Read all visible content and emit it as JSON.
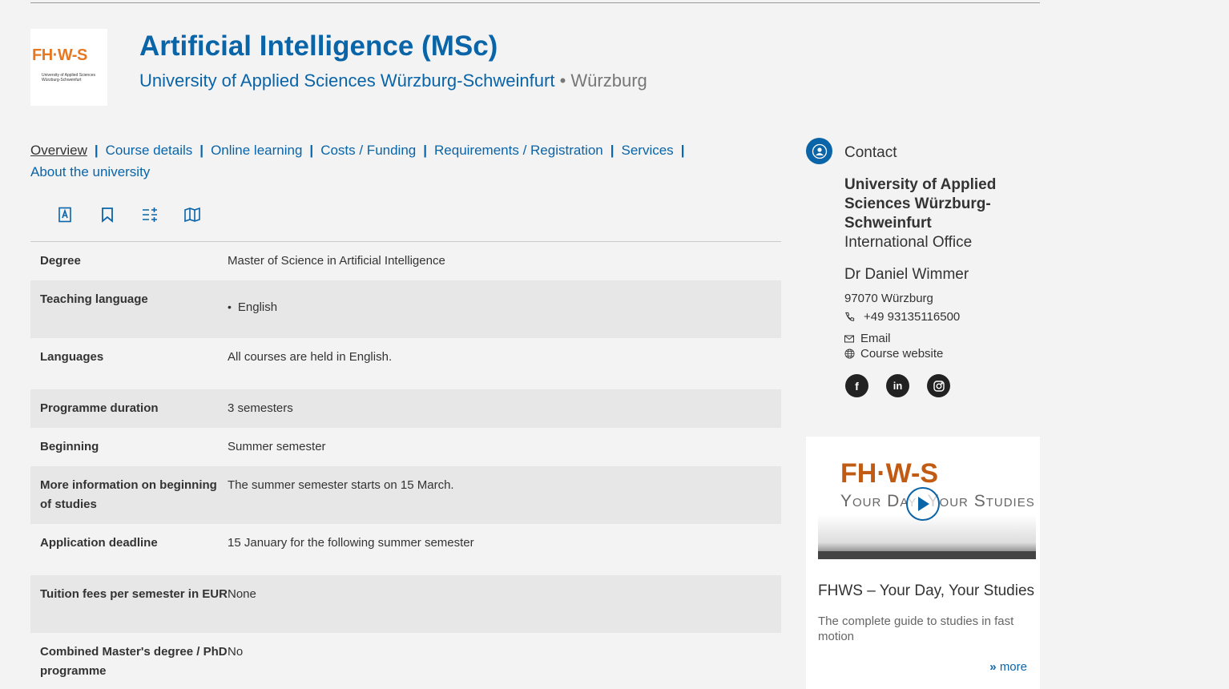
{
  "header": {
    "logo_text": "FH·W-S",
    "logo_sub": "University of Applied Sciences Würzburg-Schweinfurt",
    "title": "Artificial Intelligence (MSc)",
    "university": "University of Applied Sciences Würzburg-Schweinfurt",
    "bullet": " • ",
    "city": "Würzburg"
  },
  "nav": {
    "items": [
      "Overview",
      "Course details",
      "Online learning",
      "Costs / Funding",
      "Requirements / Registration",
      "Services",
      "About the university"
    ],
    "separator": "|"
  },
  "tools": [
    "pdf-icon",
    "bookmark-icon",
    "compare-icon",
    "map-icon"
  ],
  "details": [
    {
      "label": "Degree",
      "value": "Master of Science in Artificial Intelligence"
    },
    {
      "label": "Teaching language",
      "list": [
        "English"
      ]
    },
    {
      "label": "Languages",
      "value": "All courses are held in English."
    },
    {
      "label": "Programme duration",
      "value": "3 semesters"
    },
    {
      "label": "Beginning",
      "value": "Summer semester"
    },
    {
      "label": "More information on beginning of studies",
      "value": "The summer semester starts on 15 March."
    },
    {
      "label": "Application deadline",
      "value": "15 January for the following summer semester"
    },
    {
      "label": "Tuition fees per semester in EUR",
      "value": "None"
    },
    {
      "label": "Combined Master's degree / PhD programme",
      "value": "No"
    }
  ],
  "contact": {
    "title": "Contact",
    "org": "University of Applied Sciences Würzburg-Schweinfurt",
    "dept": "International Office",
    "name": "Dr Daniel Wimmer",
    "city": "97070 Würzburg",
    "phone": "+49 93135116500",
    "email": "Email",
    "website": "Course website",
    "socials": [
      "facebook-icon",
      "linkedin-icon",
      "instagram-icon"
    ]
  },
  "video_card": {
    "video_brand": "FH·W-S",
    "video_tagline": "Your Day, Your Studies",
    "title": "FHWS – Your Day, Your Studies",
    "description": "The complete guide to studies in fast motion",
    "more": "more",
    "more_marker": "»"
  }
}
